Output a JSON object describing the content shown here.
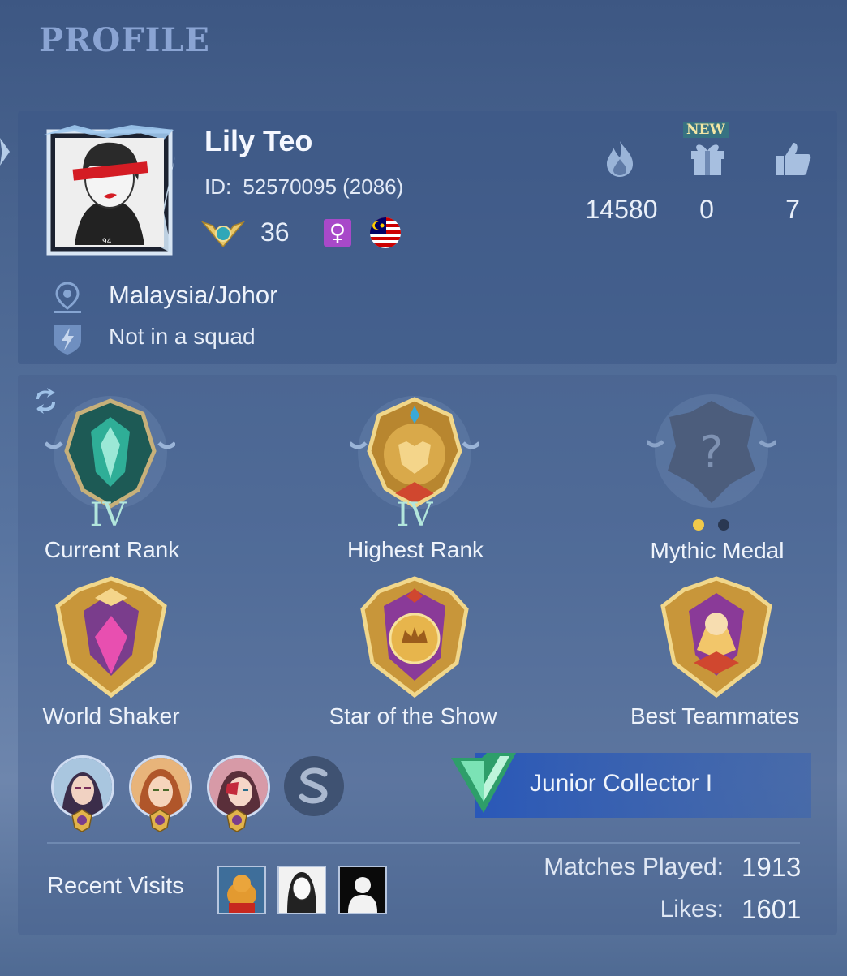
{
  "header": {
    "title": "PROFILE"
  },
  "player": {
    "name": "Lily Teo",
    "id_label": "ID:",
    "id_value": "52570095 (2086)",
    "level": "36",
    "gender_symbol": "♀",
    "location": "Malaysia/Johor",
    "squad": "Not in a squad"
  },
  "stats": {
    "popularity": "14580",
    "gifts": "0",
    "likes_top": "7",
    "new_badge": "NEW"
  },
  "badges": {
    "current_rank_label": "Current Rank",
    "current_rank_tier": "IV",
    "highest_rank_label": "Highest Rank",
    "highest_rank_tier": "IV",
    "mythic_label": "Mythic Medal",
    "world_shaker_label": "World Shaker",
    "star_show_label": "Star of the Show",
    "best_teammates_label": "Best Teammates"
  },
  "collector": {
    "title": "Junior Collector I"
  },
  "recent": {
    "label": "Recent Visits"
  },
  "summary": {
    "matches_label": "Matches Played:",
    "matches_value": "1913",
    "likes_label": "Likes:",
    "likes_value": "1601"
  },
  "colors": {
    "accent_gold": "#e9c768",
    "gender_purple": "#a849c9",
    "collector_green": "#2e9e6a"
  },
  "icons": [
    "location-pin-icon",
    "squad-shield-icon",
    "flame-icon",
    "gift-icon",
    "thumbs-up-icon",
    "refresh-icon",
    "skin-icon"
  ]
}
